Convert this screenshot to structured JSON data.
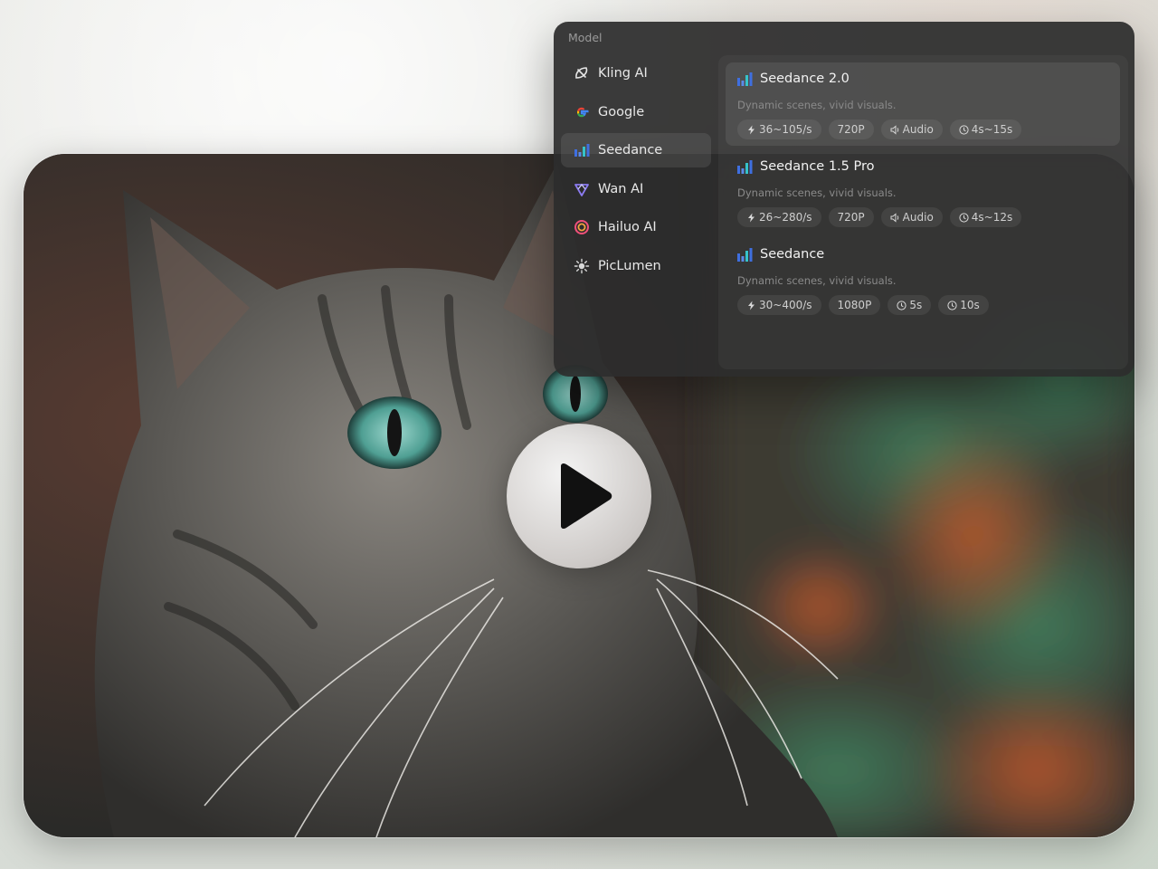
{
  "panel": {
    "title": "Model",
    "providers": [
      {
        "label": "Kling AI",
        "icon": "kling-icon",
        "active": false
      },
      {
        "label": "Google",
        "icon": "google-icon",
        "active": false
      },
      {
        "label": "Seedance",
        "icon": "seedance-icon",
        "active": true
      },
      {
        "label": "Wan AI",
        "icon": "wan-icon",
        "active": false
      },
      {
        "label": "Hailuo AI",
        "icon": "hailuo-icon",
        "active": false
      },
      {
        "label": "PicLumen",
        "icon": "piclumen-icon",
        "active": false
      }
    ],
    "models": [
      {
        "name": "Seedance 2.0",
        "description": "Dynamic scenes, vivid visuals.",
        "selected": true,
        "tags": [
          {
            "icon": "bolt-icon",
            "text": "36~105/s"
          },
          {
            "icon": "",
            "text": "720P"
          },
          {
            "icon": "speaker-icon",
            "text": "Audio"
          },
          {
            "icon": "clock-icon",
            "text": "4s~15s"
          }
        ]
      },
      {
        "name": "Seedance 1.5 Pro",
        "description": "Dynamic scenes, vivid visuals.",
        "selected": false,
        "tags": [
          {
            "icon": "bolt-icon",
            "text": "26~280/s"
          },
          {
            "icon": "",
            "text": "720P"
          },
          {
            "icon": "speaker-icon",
            "text": "Audio"
          },
          {
            "icon": "clock-icon",
            "text": "4s~12s"
          }
        ]
      },
      {
        "name": "Seedance",
        "description": "Dynamic scenes, vivid visuals.",
        "selected": false,
        "tags": [
          {
            "icon": "bolt-icon",
            "text": "30~400/s"
          },
          {
            "icon": "",
            "text": "1080P"
          },
          {
            "icon": "clock-icon",
            "text": "5s"
          },
          {
            "icon": "clock-icon",
            "text": "10s"
          }
        ]
      }
    ]
  },
  "colors": {
    "panel_bg": "#2c2c2c",
    "seedance_blue": "#3f6fe0",
    "seedance_teal": "#35c2c9"
  }
}
